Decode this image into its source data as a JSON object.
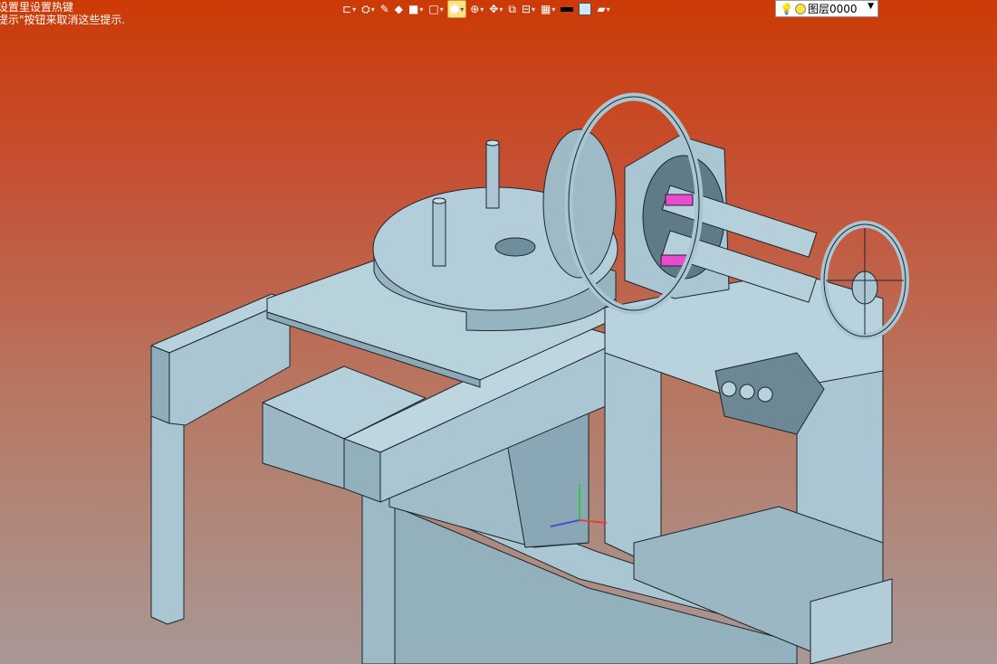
{
  "hint": {
    "line1": "设置里设置热键",
    "line2": "提示\"按钮来取消这些提示."
  },
  "toolbar": {
    "icons": [
      "selection-icon",
      "view-icon",
      "pen-icon",
      "solid-box-icon",
      "cube-icon",
      "white-cube-icon",
      "wireframe-icon",
      "zoom-icon",
      "pan-icon",
      "fit-icon",
      "section-icon",
      "layer-manager-icon",
      "line-color-icon",
      "fill-color-icon",
      "plane-icon"
    ],
    "active": "wireframe-icon"
  },
  "layer": {
    "name": "图层0000",
    "icons": [
      "bulb-icon",
      "layer-color-dot-icon"
    ]
  },
  "colors": {
    "bg_top": "#cc3a06",
    "bg_bottom": "#a89896",
    "model": "#a9c6d2",
    "model_dark": "#7f9dab",
    "model_edge": "#1c262c",
    "accent_pink": "#e94bd0"
  }
}
